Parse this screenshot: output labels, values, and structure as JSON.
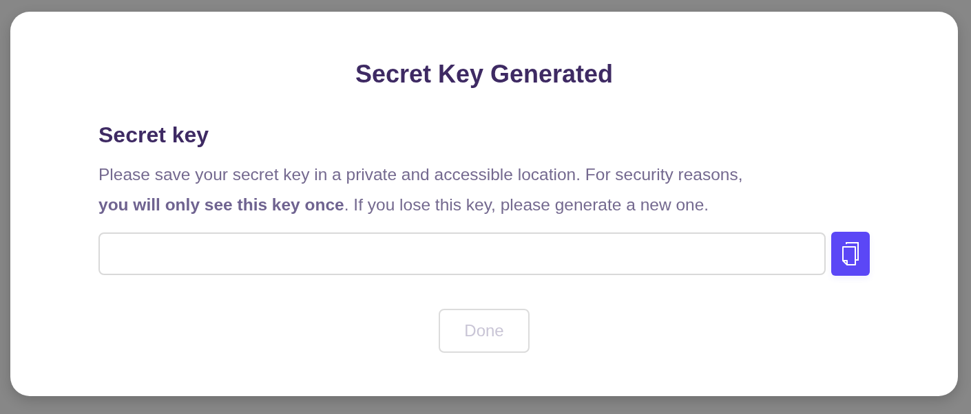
{
  "dialog": {
    "title": "Secret Key Generated",
    "section_heading": "Secret key",
    "description": "Please save your secret key in a private and accessible location. For security reasons, **you will only see this key once**. If you lose this key, please generate a new one.",
    "done_button": {
      "label": "Done",
      "disabled": true
    }
  }
}
